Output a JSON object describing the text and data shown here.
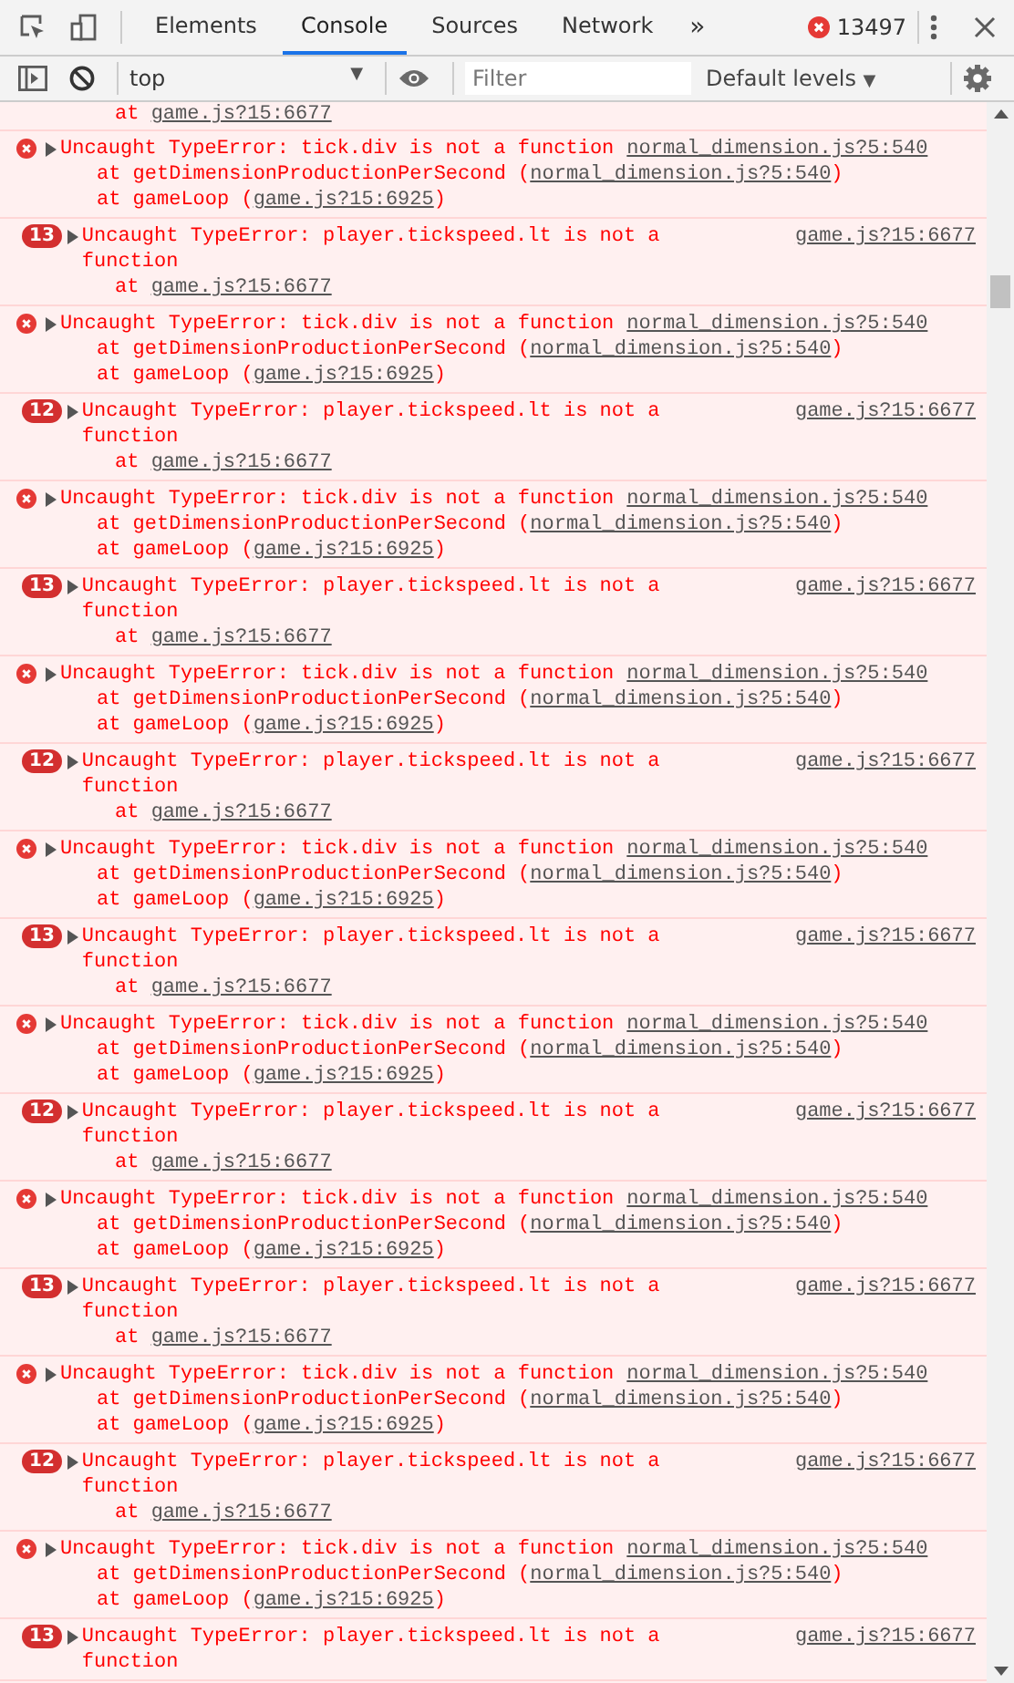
{
  "tabs": [
    {
      "label": "Elements",
      "selected": false
    },
    {
      "label": "Console",
      "selected": true
    },
    {
      "label": "Sources",
      "selected": false
    },
    {
      "label": "Network",
      "selected": false
    }
  ],
  "more_tabs": "»",
  "error_count": "13497",
  "console_toolbar": {
    "context": "top",
    "context_caret": "▼",
    "filter": {
      "placeholder": "Filter"
    },
    "levels": "Default levels",
    "levels_caret": "▼"
  },
  "top_fragment": {
    "prefix": "at ",
    "link": "game.js?15:6677"
  },
  "messages": [
    {
      "kind": "error",
      "message": "Uncaught TypeError: tick.div is not a function",
      "source": "normal_dimension.js?5:540",
      "stack": [
        {
          "prefix": "at getDimensionProductionPerSecond (",
          "link": "normal_dimension.js?5:540",
          "suffix": ")"
        },
        {
          "prefix": "at gameLoop (",
          "link": "game.js?15:6925",
          "suffix": ")"
        }
      ]
    },
    {
      "kind": "repeat",
      "count": "13",
      "message": "Uncaught TypeError: player.tickspeed.lt is not a function",
      "source": "game.js?15:6677",
      "stack": [
        {
          "prefix": "at ",
          "link": "game.js?15:6677"
        }
      ]
    },
    {
      "kind": "error",
      "message": "Uncaught TypeError: tick.div is not a function",
      "source": "normal_dimension.js?5:540",
      "stack": [
        {
          "prefix": "at getDimensionProductionPerSecond (",
          "link": "normal_dimension.js?5:540",
          "suffix": ")"
        },
        {
          "prefix": "at gameLoop (",
          "link": "game.js?15:6925",
          "suffix": ")"
        }
      ]
    },
    {
      "kind": "repeat",
      "count": "12",
      "message": "Uncaught TypeError: player.tickspeed.lt is not a function",
      "source": "game.js?15:6677",
      "stack": [
        {
          "prefix": "at ",
          "link": "game.js?15:6677"
        }
      ]
    },
    {
      "kind": "error",
      "message": "Uncaught TypeError: tick.div is not a function",
      "source": "normal_dimension.js?5:540",
      "stack": [
        {
          "prefix": "at getDimensionProductionPerSecond (",
          "link": "normal_dimension.js?5:540",
          "suffix": ")"
        },
        {
          "prefix": "at gameLoop (",
          "link": "game.js?15:6925",
          "suffix": ")"
        }
      ]
    },
    {
      "kind": "repeat",
      "count": "13",
      "message": "Uncaught TypeError: player.tickspeed.lt is not a function",
      "source": "game.js?15:6677",
      "stack": [
        {
          "prefix": "at ",
          "link": "game.js?15:6677"
        }
      ]
    },
    {
      "kind": "error",
      "message": "Uncaught TypeError: tick.div is not a function",
      "source": "normal_dimension.js?5:540",
      "stack": [
        {
          "prefix": "at getDimensionProductionPerSecond (",
          "link": "normal_dimension.js?5:540",
          "suffix": ")"
        },
        {
          "prefix": "at gameLoop (",
          "link": "game.js?15:6925",
          "suffix": ")"
        }
      ]
    },
    {
      "kind": "repeat",
      "count": "12",
      "message": "Uncaught TypeError: player.tickspeed.lt is not a function",
      "source": "game.js?15:6677",
      "stack": [
        {
          "prefix": "at ",
          "link": "game.js?15:6677"
        }
      ]
    },
    {
      "kind": "error",
      "message": "Uncaught TypeError: tick.div is not a function",
      "source": "normal_dimension.js?5:540",
      "stack": [
        {
          "prefix": "at getDimensionProductionPerSecond (",
          "link": "normal_dimension.js?5:540",
          "suffix": ")"
        },
        {
          "prefix": "at gameLoop (",
          "link": "game.js?15:6925",
          "suffix": ")"
        }
      ]
    },
    {
      "kind": "repeat",
      "count": "13",
      "message": "Uncaught TypeError: player.tickspeed.lt is not a function",
      "source": "game.js?15:6677",
      "stack": [
        {
          "prefix": "at ",
          "link": "game.js?15:6677"
        }
      ]
    },
    {
      "kind": "error",
      "message": "Uncaught TypeError: tick.div is not a function",
      "source": "normal_dimension.js?5:540",
      "stack": [
        {
          "prefix": "at getDimensionProductionPerSecond (",
          "link": "normal_dimension.js?5:540",
          "suffix": ")"
        },
        {
          "prefix": "at gameLoop (",
          "link": "game.js?15:6925",
          "suffix": ")"
        }
      ]
    },
    {
      "kind": "repeat",
      "count": "12",
      "message": "Uncaught TypeError: player.tickspeed.lt is not a function",
      "source": "game.js?15:6677",
      "stack": [
        {
          "prefix": "at ",
          "link": "game.js?15:6677"
        }
      ]
    },
    {
      "kind": "error",
      "message": "Uncaught TypeError: tick.div is not a function",
      "source": "normal_dimension.js?5:540",
      "stack": [
        {
          "prefix": "at getDimensionProductionPerSecond (",
          "link": "normal_dimension.js?5:540",
          "suffix": ")"
        },
        {
          "prefix": "at gameLoop (",
          "link": "game.js?15:6925",
          "suffix": ")"
        }
      ]
    },
    {
      "kind": "repeat",
      "count": "13",
      "message": "Uncaught TypeError: player.tickspeed.lt is not a function",
      "source": "game.js?15:6677",
      "stack": [
        {
          "prefix": "at ",
          "link": "game.js?15:6677"
        }
      ]
    },
    {
      "kind": "error",
      "message": "Uncaught TypeError: tick.div is not a function",
      "source": "normal_dimension.js?5:540",
      "stack": [
        {
          "prefix": "at getDimensionProductionPerSecond (",
          "link": "normal_dimension.js?5:540",
          "suffix": ")"
        },
        {
          "prefix": "at gameLoop (",
          "link": "game.js?15:6925",
          "suffix": ")"
        }
      ]
    },
    {
      "kind": "repeat",
      "count": "12",
      "message": "Uncaught TypeError: player.tickspeed.lt is not a function",
      "source": "game.js?15:6677",
      "stack": [
        {
          "prefix": "at ",
          "link": "game.js?15:6677"
        }
      ]
    },
    {
      "kind": "error",
      "message": "Uncaught TypeError: tick.div is not a function",
      "source": "normal_dimension.js?5:540",
      "stack": [
        {
          "prefix": "at getDimensionProductionPerSecond (",
          "link": "normal_dimension.js?5:540",
          "suffix": ")"
        },
        {
          "prefix": "at gameLoop (",
          "link": "game.js?15:6925",
          "suffix": ")"
        }
      ]
    },
    {
      "kind": "repeat",
      "count": "13",
      "message": "Uncaught TypeError: player.tickspeed.lt is not a function",
      "source": "game.js?15:6677"
    }
  ]
}
